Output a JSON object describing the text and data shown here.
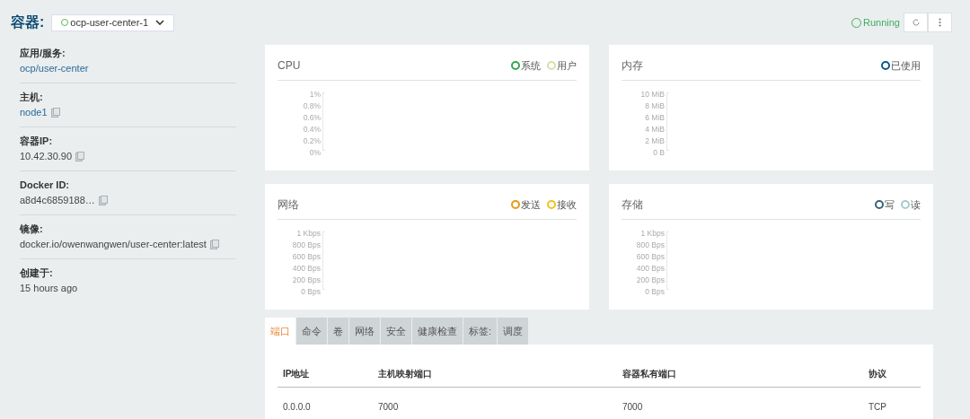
{
  "header": {
    "title": "容器:",
    "container_select": {
      "value": "ocp-user-center-1"
    },
    "status": "Running"
  },
  "details": [
    {
      "label": "应用/服务:",
      "value": "ocp/user-center",
      "kind": "link",
      "copyable": false
    },
    {
      "label": "主机:",
      "value": "node1",
      "kind": "link",
      "copyable": true
    },
    {
      "label": "容器IP:",
      "value": "10.42.30.90",
      "kind": "text",
      "copyable": true
    },
    {
      "label": "Docker ID:",
      "value": "a8d4c6859188…",
      "kind": "text",
      "copyable": true
    },
    {
      "label": "镜像:",
      "value": "docker.io/owenwangwen/user-center:latest",
      "kind": "text",
      "copyable": true
    },
    {
      "label": "创建于:",
      "value": "15 hours ago",
      "kind": "text",
      "copyable": false
    }
  ],
  "charts": [
    {
      "title": "CPU",
      "legend": [
        {
          "name": "系统",
          "color": "#2fa84f"
        },
        {
          "name": "用户",
          "color": "#d4e3a6"
        }
      ],
      "y_labels": [
        "1%",
        "0.8%",
        "0.6%",
        "0.4%",
        "0.2%",
        "0%"
      ]
    },
    {
      "title": "内存",
      "legend": [
        {
          "name": "已使用",
          "color": "#0b5a86"
        }
      ],
      "y_labels": [
        "10 MiB",
        "8 MiB",
        "6 MiB",
        "4 MiB",
        "2 MiB",
        "0 B"
      ]
    },
    {
      "title": "网络",
      "legend": [
        {
          "name": "发送",
          "color": "#e59b0f"
        },
        {
          "name": "接收",
          "color": "#f0c419"
        }
      ],
      "y_labels": [
        "1 Kbps",
        "800 Bps",
        "600 Bps",
        "400 Bps",
        "200 Bps",
        "0 Bps"
      ]
    },
    {
      "title": "存储",
      "legend": [
        {
          "name": "写",
          "color": "#37627b"
        },
        {
          "name": "读",
          "color": "#a7ccd0"
        }
      ],
      "y_labels": [
        "1 Kbps",
        "800 Bps",
        "600 Bps",
        "400 Bps",
        "200 Bps",
        "0 Bps"
      ]
    }
  ],
  "tabs": [
    {
      "label": "端口",
      "selected": true
    },
    {
      "label": "命令",
      "selected": false
    },
    {
      "label": "卷",
      "selected": false
    },
    {
      "label": "网络",
      "selected": false
    },
    {
      "label": "安全",
      "selected": false
    },
    {
      "label": "健康检查",
      "selected": false
    },
    {
      "label": "标签:",
      "selected": false
    },
    {
      "label": "调度",
      "selected": false
    }
  ],
  "ports_table": {
    "columns": [
      "IP地址",
      "主机映射端口",
      "容器私有端口",
      "协议"
    ],
    "rows": [
      [
        "0.0.0.0",
        "7000",
        "7000",
        "TCP"
      ]
    ]
  }
}
